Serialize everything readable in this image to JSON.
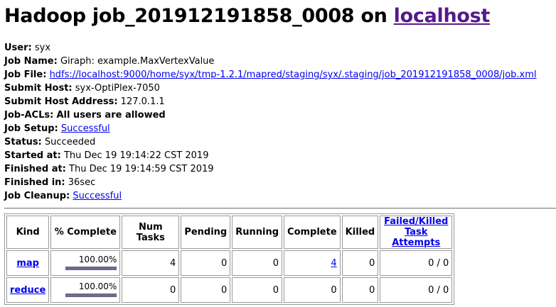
{
  "title": {
    "prefix": "Hadoop job_201912191858_0008 on ",
    "host_link": "localhost"
  },
  "info": {
    "user_label": "User:",
    "user_value": "syx",
    "jobname_label": "Job Name:",
    "jobname_value": "Giraph: example.MaxVertexValue",
    "jobfile_label": "Job File:",
    "jobfile_value": "hdfs://localhost:9000/home/syx/tmp-1.2.1/mapred/staging/syx/.staging/job_201912191858_0008/job.xml",
    "submithost_label": "Submit Host:",
    "submithost_value": "syx-OptiPlex-7050",
    "submitaddr_label": "Submit Host Address:",
    "submitaddr_value": "127.0.1.1",
    "acls_label": "Job-ACLs:",
    "acls_value": "All users are allowed",
    "setup_label": "Job Setup:",
    "setup_value": "Successful",
    "status_label": "Status:",
    "status_value": "Succeeded",
    "started_label": "Started at:",
    "started_value": "Thu Dec 19 19:14:22 CST 2019",
    "finished_label": "Finished at:",
    "finished_value": "Thu Dec 19 19:14:59 CST 2019",
    "finishedin_label": "Finished in:",
    "finishedin_value": "36sec",
    "cleanup_label": "Job Cleanup:",
    "cleanup_value": "Successful"
  },
  "table": {
    "headers": {
      "kind": "Kind",
      "complete_pct": "% Complete",
      "num_tasks": "Num Tasks",
      "pending": "Pending",
      "running": "Running",
      "complete": "Complete",
      "killed": "Killed",
      "failed_line1": "Failed/Killed",
      "failed_line2": "Task Attempts"
    },
    "rows": [
      {
        "kind": "map",
        "percent": "100.00%",
        "fraction": 1.0,
        "num_tasks": "4",
        "pending": "0",
        "running": "0",
        "complete": "4",
        "killed": "0",
        "failed": "0 / 0"
      },
      {
        "kind": "reduce",
        "percent": "100.00%",
        "fraction": 1.0,
        "num_tasks": "0",
        "pending": "0",
        "running": "0",
        "complete": "0",
        "killed": "0",
        "failed": "0 / 0"
      }
    ]
  }
}
